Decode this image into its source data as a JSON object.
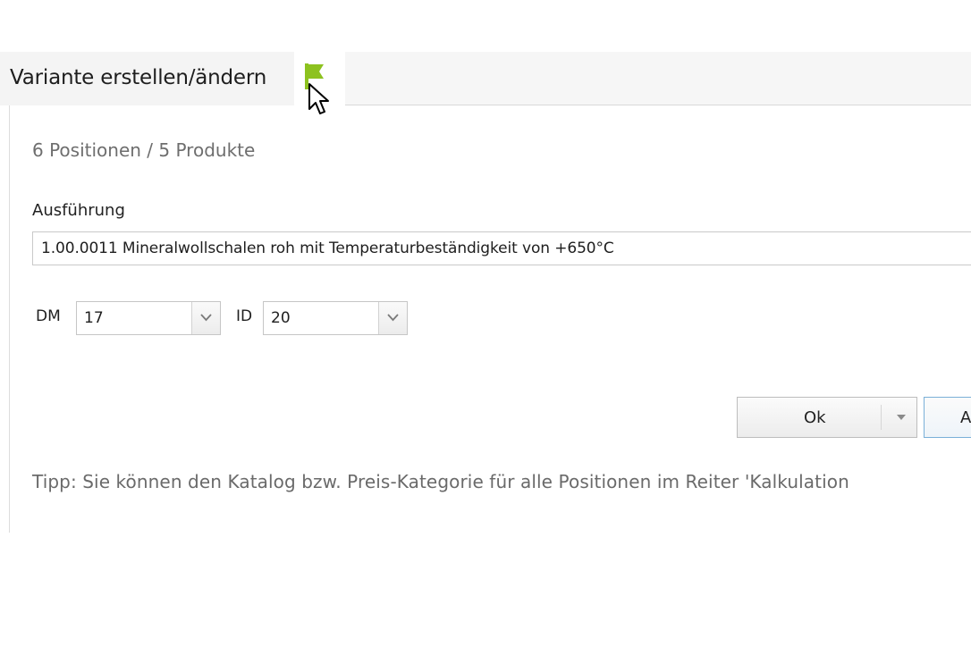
{
  "tab": {
    "title": "Variante erstellen/ändern",
    "flag_icon": "flag-icon",
    "flag_color": "#8dc21f"
  },
  "panel": {
    "summary": "6 Positionen / 5 Produkte",
    "execution": {
      "label": "Ausführung",
      "value": "1.00.0011 Mineralwollschalen roh mit Temperaturbeständigkeit von +650°C"
    },
    "dm": {
      "label": "DM",
      "value": "17"
    },
    "id": {
      "label": "ID",
      "value": "20"
    },
    "buttons": {
      "ok_label": "Ok",
      "second_label": "A"
    },
    "tip": "Tipp: Sie können den Katalog bzw. Preis-Kategorie für alle Positionen im Reiter 'Kalkulation"
  },
  "colors": {
    "accent_flag": "#8dc21f",
    "focus_border": "#7ab0d8"
  }
}
